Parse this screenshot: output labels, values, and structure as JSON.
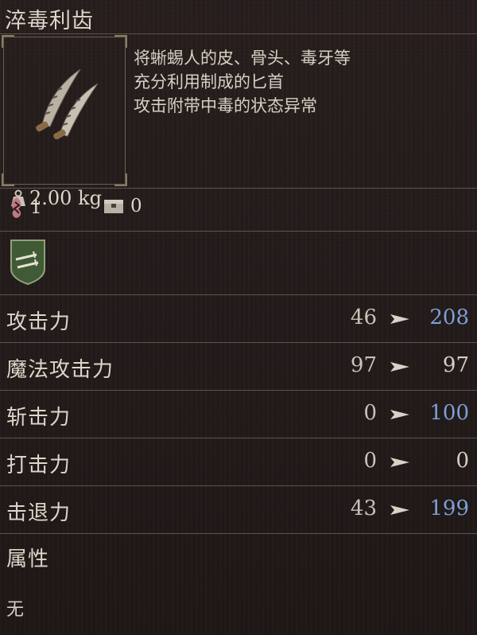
{
  "item": {
    "title": "淬毒利齿",
    "weight": "2.00 kg",
    "description": [
      "将蜥蜴人的皮、骨头、毒牙等",
      "充分利用制成的匕首",
      "攻击附带中毒的状态异常"
    ]
  },
  "counts": {
    "rune_count": "1",
    "storage_count": "0"
  },
  "badge": {
    "icon": "dual-dagger-shield-icon",
    "color": "#3f5a34"
  },
  "stats": [
    {
      "label": "攻击力",
      "base": "46",
      "new": "208",
      "new_color": "#7e9fd6"
    },
    {
      "label": "魔法攻击力",
      "base": "97",
      "new": "97",
      "new_color": "#d6cfc2"
    },
    {
      "label": "斩击力",
      "base": "0",
      "new": "100",
      "new_color": "#7e9fd6"
    },
    {
      "label": "打击力",
      "base": "0",
      "new": "0",
      "new_color": "#d6cfc2"
    },
    {
      "label": "击退力",
      "base": "43",
      "new": "199",
      "new_color": "#7e9fd6"
    }
  ],
  "attribute": {
    "label": "属性",
    "value": "无"
  }
}
